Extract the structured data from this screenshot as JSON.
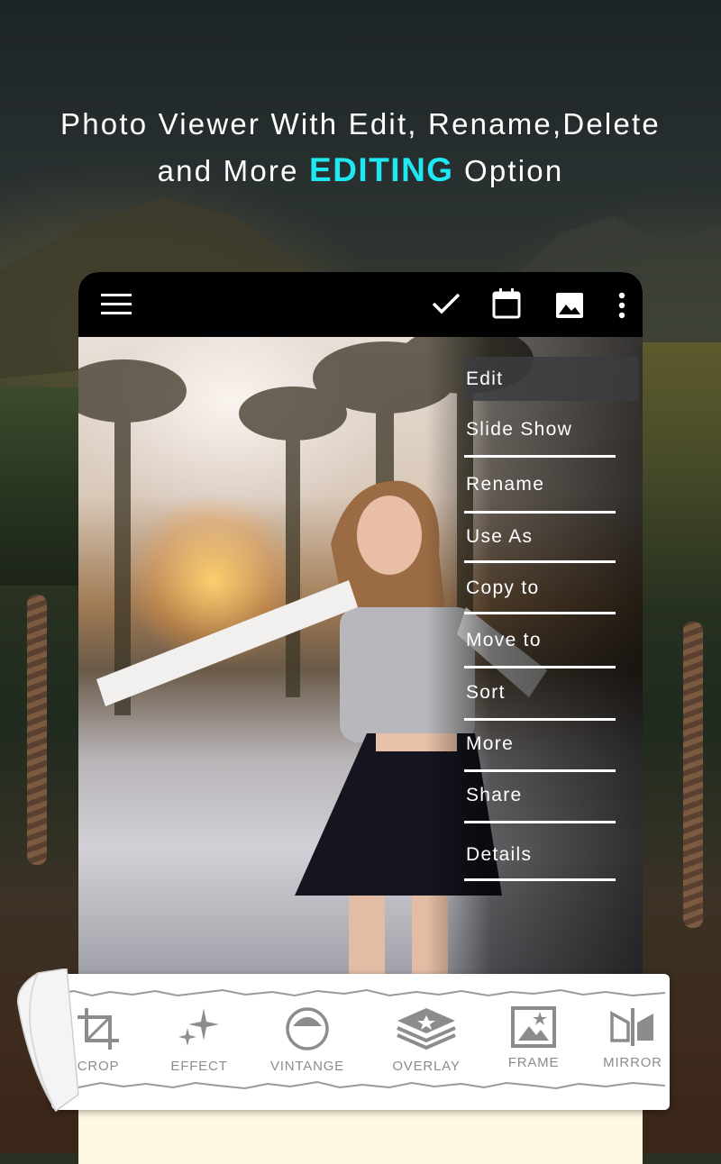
{
  "headline": {
    "line1": "Photo Viewer With Edit, Rename,Delete",
    "line2_prefix": "and More ",
    "line2_accent": "EDITING",
    "line2_suffix": " Option"
  },
  "colors": {
    "accent": "#1fe8f2",
    "toolbar": "#000000",
    "menu_text": "#ffffff",
    "tool_label": "#8c8c8c"
  },
  "toolbar": {
    "icons": [
      "menu-icon",
      "check-icon",
      "calendar-icon",
      "image-icon",
      "more-vert-icon"
    ]
  },
  "menu": {
    "items": [
      {
        "label": "Edit",
        "active": true
      },
      {
        "label": "Slide Show"
      },
      {
        "label": "Rename"
      },
      {
        "label": "Use As"
      },
      {
        "label": "Copy to"
      },
      {
        "label": "Move to"
      },
      {
        "label": "Sort"
      },
      {
        "label": "More"
      },
      {
        "label": "Share"
      },
      {
        "label": "Details"
      }
    ]
  },
  "tools": [
    {
      "label": "CROP",
      "icon": "crop-icon"
    },
    {
      "label": "EFFECT",
      "icon": "sparkle-icon"
    },
    {
      "label": "VINTANGE",
      "icon": "vintage-icon"
    },
    {
      "label": "OVERLAY",
      "icon": "layers-icon"
    },
    {
      "label": "FRAME",
      "icon": "frame-icon"
    },
    {
      "label": "MIRROR",
      "icon": "mirror-icon"
    }
  ]
}
